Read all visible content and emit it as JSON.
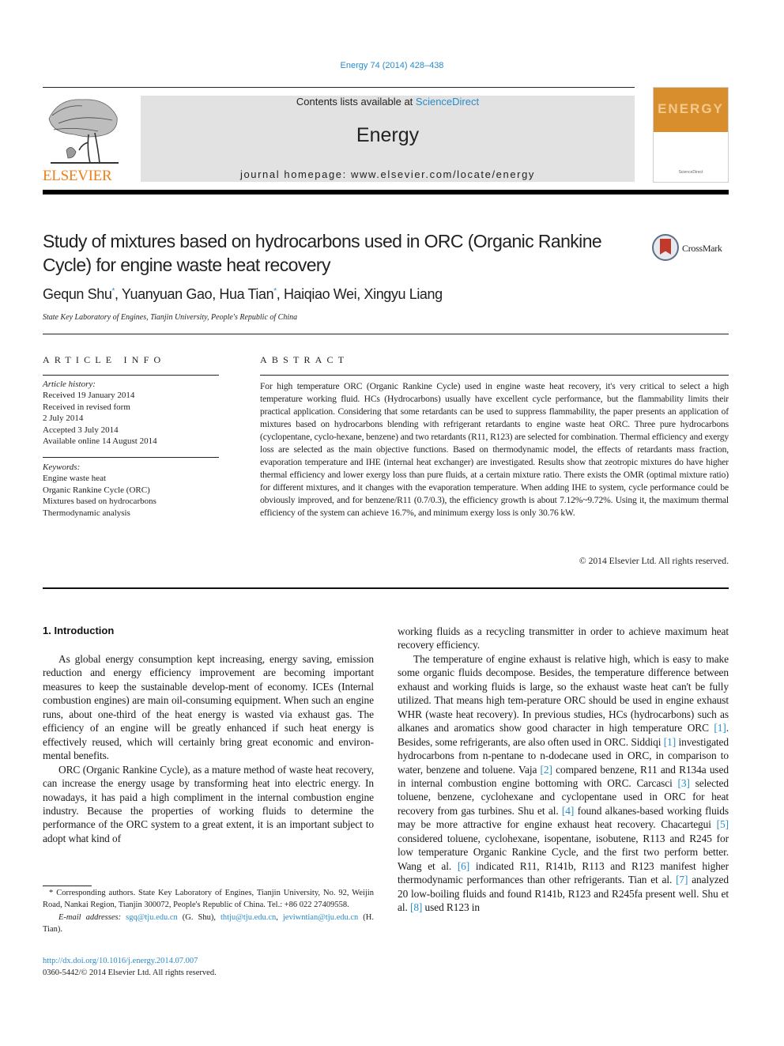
{
  "header": {
    "journal_reference": "Energy 74 (2014) 428–438",
    "contents_prefix": "Contents lists available at ",
    "contents_link": "ScienceDirect",
    "journal_name": "Energy",
    "homepage": "journal homepage: www.elsevier.com/locate/energy",
    "publisher_logo_text": "ELSEVIER",
    "cover_title": "ENERGY",
    "cover_footer": "ScienceDirect",
    "colors": {
      "link": "#2a8bc7",
      "publisher": "#f07f1a",
      "cover": "#d98e2e",
      "banner": "#e2e2e2"
    }
  },
  "article": {
    "title": "Study of mixtures based on hydrocarbons used in ORC (Organic Rankine Cycle) for engine waste heat recovery",
    "crossmark_label": "CrossMark",
    "authors": [
      {
        "name": "Gequn Shu",
        "corresponding": "*"
      },
      {
        "name": "Yuanyuan Gao"
      },
      {
        "name": "Hua Tian",
        "corresponding": "*"
      },
      {
        "name": "Haiqiao Wei"
      },
      {
        "name": "Xingyu Liang"
      }
    ],
    "affiliation": "State Key Laboratory of Engines, Tianjin University, People's Republic of China"
  },
  "article_info": {
    "heading": "ARTICLE INFO",
    "history_label": "Article history:",
    "history": [
      "Received 19 January 2014",
      "Received in revised form",
      "2 July 2014",
      "Accepted 3 July 2014",
      "Available online 14 August 2014"
    ],
    "keywords_label": "Keywords:",
    "keywords": [
      "Engine waste heat",
      "Organic Rankine Cycle (ORC)",
      "Mixtures based on hydrocarbons",
      "Thermodynamic analysis"
    ]
  },
  "abstract": {
    "heading": "ABSTRACT",
    "text": "For high temperature ORC (Organic Rankine Cycle) used in engine waste heat recovery, it's very critical to select a high temperature working fluid. HCs (Hydrocarbons) usually have excellent cycle performance, but the flammability limits their practical application. Considering that some retardants can be used to suppress flammability, the paper presents an application of mixtures based on hydrocarbons blending with refrigerant retardants to engine waste heat ORC. Three pure hydrocarbons (cyclopentane, cyclo-hexane, benzene) and two retardants (R11, R123) are selected for combination. Thermal efficiency and exergy loss are selected as the main objective functions. Based on thermodynamic model, the effects of retardants mass fraction, evaporation temperature and IHE (internal heat exchanger) are investigated. Results show that zeotropic mixtures do have higher thermal efficiency and lower exergy loss than pure fluids, at a certain mixture ratio. There exists the OMR (optimal mixture ratio) for different mixtures, and it changes with the evaporation temperature. When adding IHE to system, cycle performance could be obviously improved, and for benzene/R11 (0.7/0.3), the efficiency growth is about 7.12%~9.72%. Using it, the maximum thermal efficiency of the system can achieve 16.7%, and minimum exergy loss is only 30.76 kW.",
    "copyright": "© 2014 Elsevier Ltd. All rights reserved."
  },
  "body": {
    "section_heading": "1.  Introduction",
    "left_paragraphs": [
      "As global energy consumption kept increasing, energy saving, emission reduction and energy efficiency improvement are becoming important measures to keep the sustainable develop-ment of economy. ICEs (Internal combustion engines) are main oil-consuming equipment. When such an engine runs, about one-third of the heat energy is wasted via exhaust gas. The efficiency of an engine will be greatly enhanced if such heat energy is effectively reused, which will certainly bring great economic and environ-mental benefits.",
      "ORC (Organic Rankine Cycle), as a mature method of waste heat recovery, can increase the energy usage by transforming heat into electric energy. In nowadays, it has paid a high compliment in the internal combustion engine industry. Because the properties of working fluids to determine the performance of the ORC system to a great extent, it is an important subject to adopt what kind of"
    ],
    "right_continuation": "working fluids as a recycling transmitter in order to achieve maximum heat recovery efficiency.",
    "right_paragraph_segments": [
      "The temperature of engine exhaust is relative high, which is easy to make some organic fluids decompose. Besides, the temperature difference between exhaust and working fluids is large, so the exhaust waste heat can't be fully utilized. That means high tem-perature ORC should be used in engine exhaust WHR (waste heat recovery). In previous studies, HCs (hydrocarbons) such as alkanes and aromatics show good character in high temperature ORC ",
      ". Besides, some refrigerants, are also often used in ORC. Siddiqi ",
      " investigated hydrocarbons from n-pentane to n-dodecane used in ORC, in comparison to water, benzene and toluene. Vaja ",
      " compared benzene, R11 and R134a used in internal combustion engine bottoming with ORC. Carcasci ",
      " selected toluene, benzene, cyclohexane and cyclopentane used in ORC for heat recovery from gas turbines. Shu et al. ",
      " found alkanes-based working fluids may be more attractive for engine exhaust heat recovery. Chacartegui ",
      " considered toluene, cyclohexane, isopentane, isobutene, R113 and R245 for low temperature Organic Rankine Cycle, and the first two perform better. Wang et al. ",
      " indicated R11, R141b, R113 and R123 manifest higher thermodynamic performances than other refrigerants. Tian et al. ",
      " analyzed 20 low-boiling fluids and found R141b, R123 and R245fa present well. Shu et al. ",
      " used R123 in"
    ],
    "citations": [
      "[1]",
      "[1]",
      "[2]",
      "[3]",
      "[4]",
      "[5]",
      "[6]",
      "[7]",
      "[8]"
    ]
  },
  "footnotes": {
    "corresponding": "* Corresponding authors. State Key Laboratory of Engines, Tianjin University, No. 92, Weijin Road, Nankai Region, Tianjin 300072, People's Republic of China. Tel.: +86 022 27409558.",
    "email_label": "E-mail addresses:",
    "emails": [
      {
        "address": "sgq@tju.edu.cn",
        "owner": " (G. Shu), "
      },
      {
        "address": "thtju@tju.edu.cn",
        "owner": ", "
      },
      {
        "address": "jeviwntian@tju.edu.cn",
        "owner": " (H. Tian)."
      }
    ],
    "doi": "http://dx.doi.org/10.1016/j.energy.2014.07.007",
    "issn": "0360-5442/© 2014 Elsevier Ltd. All rights reserved."
  }
}
